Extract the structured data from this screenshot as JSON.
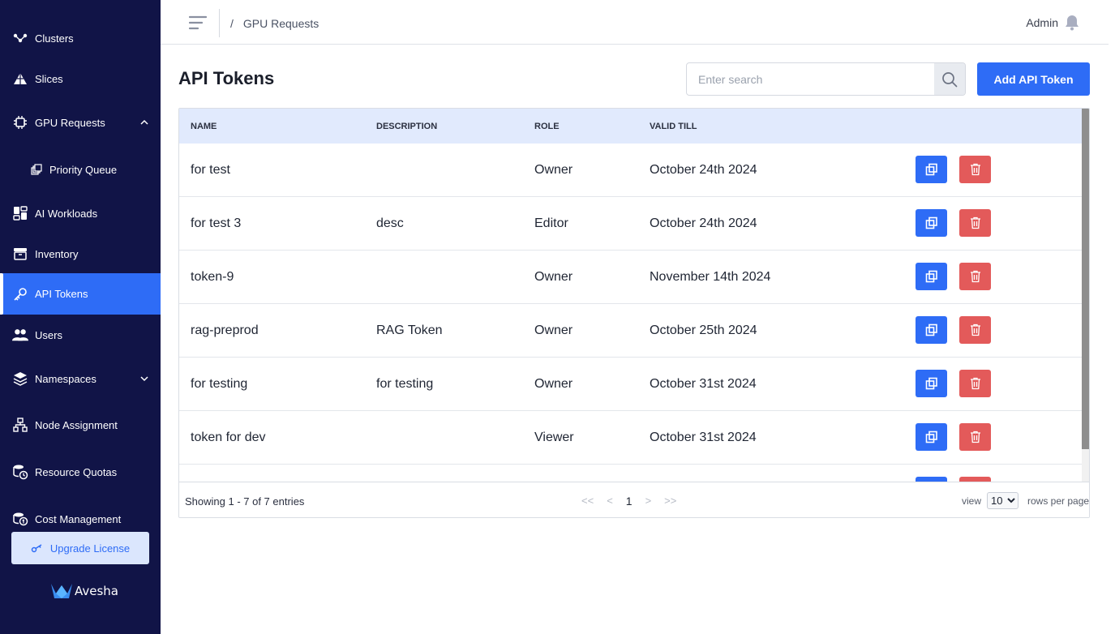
{
  "sidebar": {
    "items": [
      {
        "label": "Clusters",
        "icon": "clusters-icon"
      },
      {
        "label": "Slices",
        "icon": "slices-icon"
      },
      {
        "label": "GPU Requests",
        "icon": "chip-icon",
        "expanded": true
      },
      {
        "label": "Priority Queue",
        "icon": "queue-icon"
      },
      {
        "label": "AI Workloads",
        "icon": "workloads-icon"
      },
      {
        "label": "Inventory",
        "icon": "inventory-icon"
      },
      {
        "label": "API Tokens",
        "icon": "key-icon",
        "active": true
      },
      {
        "label": "Users",
        "icon": "users-icon"
      },
      {
        "label": "Namespaces",
        "icon": "layers-icon",
        "expanded": false
      },
      {
        "label": "Node Assignment",
        "icon": "hierarchy-icon"
      },
      {
        "label": "Resource Quotas",
        "icon": "quota-icon"
      },
      {
        "label": "Cost Management",
        "icon": "cost-icon"
      }
    ],
    "upgrade_label": "Upgrade License",
    "brand": "Avesha"
  },
  "header": {
    "breadcrumb_sep": "/",
    "breadcrumb": "GPU Requests",
    "user": "Admin"
  },
  "main": {
    "title": "API Tokens",
    "search_placeholder": "Enter search",
    "add_button": "Add API Token",
    "columns": [
      "NAME",
      "DESCRIPTION",
      "ROLE",
      "VALID TILL"
    ],
    "rows": [
      {
        "name": "for test",
        "description": "",
        "role": "Owner",
        "valid_till": "October 24th 2024"
      },
      {
        "name": "for test 3",
        "description": "desc",
        "role": "Editor",
        "valid_till": "October 24th 2024"
      },
      {
        "name": "token-9",
        "description": "",
        "role": "Owner",
        "valid_till": "November 14th 2024"
      },
      {
        "name": "rag-preprod",
        "description": "RAG Token",
        "role": "Owner",
        "valid_till": "October 25th 2024"
      },
      {
        "name": "for testing",
        "description": "for testing",
        "role": "Owner",
        "valid_till": "October 31st 2024"
      },
      {
        "name": "token for dev",
        "description": "",
        "role": "Viewer",
        "valid_till": "October 31st 2024"
      }
    ],
    "footer": {
      "showing": "Showing 1 - 7 of 7 entries",
      "first": "<<",
      "prev": "<",
      "page": "1",
      "next": ">",
      "last": ">>",
      "view_label": "view",
      "rows_per_page_value": "10",
      "rows_per_page_label": "rows per page"
    }
  },
  "colors": {
    "sidebar_bg": "#111447",
    "accent": "#2e6cf6",
    "danger": "#e35a5a",
    "table_header_bg": "#e1eafd"
  }
}
